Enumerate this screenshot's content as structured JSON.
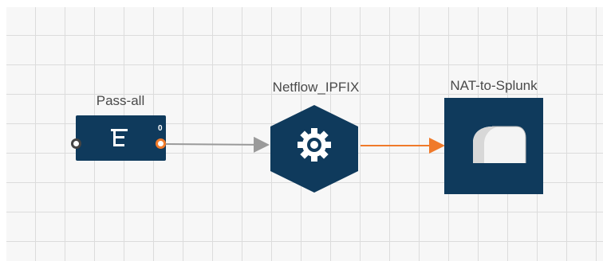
{
  "pipeline": {
    "nodes": [
      {
        "label": "Pass-all",
        "type": "filter",
        "icon": "filter-icon",
        "output_port": "0"
      },
      {
        "label": "Netflow_IPFIX",
        "type": "processor",
        "icon": "gear-icon"
      },
      {
        "label": "NAT-to-Splunk",
        "type": "destination",
        "icon": "pipe-icon"
      }
    ],
    "connections": [
      {
        "from": "Pass-all",
        "to": "Netflow_IPFIX",
        "color": "#9a9a9a"
      },
      {
        "from": "Netflow_IPFIX",
        "to": "NAT-to-Splunk",
        "color": "#f07a2a"
      }
    ]
  },
  "colors": {
    "node_fill": "#0f3a5c",
    "accent": "#f07a2a",
    "grid": "#dcdcdc"
  }
}
